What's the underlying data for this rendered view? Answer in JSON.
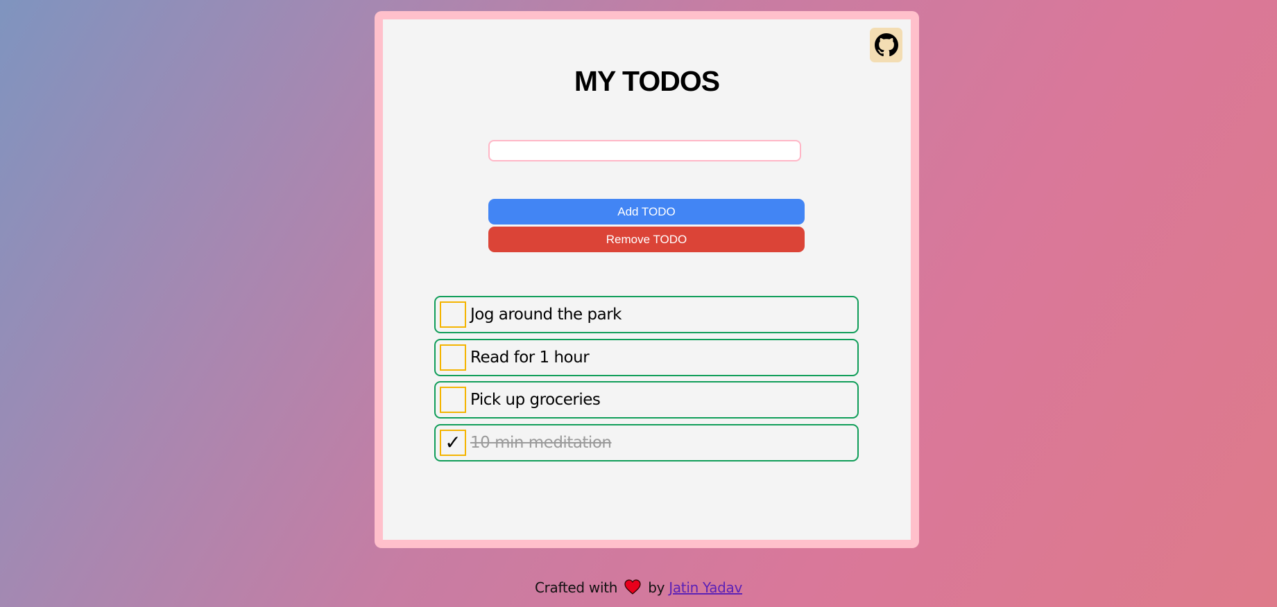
{
  "app": {
    "title": "MY TODOS"
  },
  "input": {
    "value": "",
    "placeholder": ""
  },
  "buttons": {
    "add_label": "Add TODO",
    "remove_label": "Remove TODO"
  },
  "todos": [
    {
      "text": "Jog around the park",
      "done": false
    },
    {
      "text": "Read for 1 hour",
      "done": false
    },
    {
      "text": "Pick up groceries",
      "done": false
    },
    {
      "text": "10 min meditation",
      "done": true
    }
  ],
  "checkmark_glyph": "✓",
  "footer": {
    "prefix": "Crafted with",
    "heart_icon": "heart-icon",
    "by": "by",
    "author_link": "Jatin Yadav"
  },
  "icons": {
    "github": "github-icon"
  },
  "colors": {
    "frame": "#ffc0cb",
    "card": "#f4f4f4",
    "add_button": "#4285f4",
    "remove_button": "#db4437",
    "item_border": "#0f9d58",
    "checkbox_border": "#f4b400",
    "github_button_bg": "#f3ddb3",
    "link": "#5b21b6"
  }
}
